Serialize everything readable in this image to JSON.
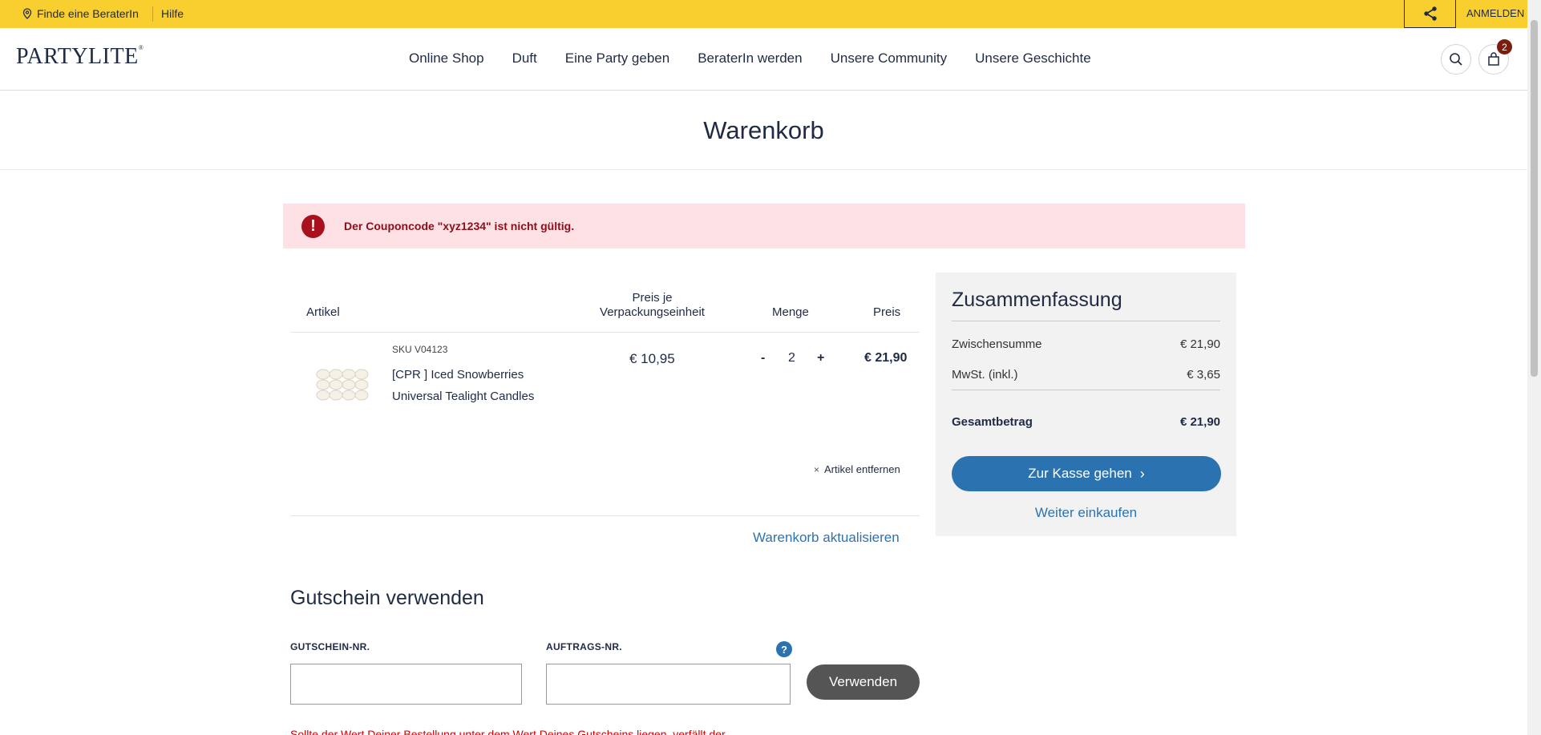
{
  "topbar": {
    "find_consultant": "Finde eine BeraterIn",
    "help": "Hilfe",
    "login": "ANMELDEN"
  },
  "header": {
    "logo": "PARTYLITE",
    "nav": [
      "Online Shop",
      "Duft",
      "Eine Party geben",
      "BeraterIn werden",
      "Unsere Community",
      "Unsere Geschichte"
    ],
    "cart_count": "2"
  },
  "page_title": "Warenkorb",
  "alert": {
    "icon": "!",
    "message": "Der Couponcode \"xyz1234\" ist nicht gültig."
  },
  "cart": {
    "headers": {
      "article": "Artikel",
      "unit_price": "Preis je Verpackungseinheit",
      "quantity": "Menge",
      "price": "Preis"
    },
    "item": {
      "sku": "SKU V04123",
      "name": "[CPR ] Iced Snowberries Universal Tealight Candles",
      "unit_price": "€ 10,95",
      "qty_minus": "-",
      "qty": "2",
      "qty_plus": "+",
      "total": "€ 21,90",
      "remove": "Artikel entfernen",
      "remove_icon": "×"
    },
    "update": "Warenkorb aktualisieren"
  },
  "summary": {
    "title": "Zusammenfassung",
    "subtotal_label": "Zwischensumme",
    "subtotal": "€ 21,90",
    "vat_label": "MwSt. (inkl.)",
    "vat": "€ 3,65",
    "total_label": "Gesamtbetrag",
    "total": "€ 21,90",
    "checkout": "Zur Kasse gehen",
    "checkout_icon": "›",
    "continue": "Weiter einkaufen"
  },
  "coupon": {
    "title": "Gutschein verwenden",
    "voucher_label": "GUTSCHEIN-NR.",
    "order_label": "AUFTRAGS-NR.",
    "help_icon": "?",
    "apply": "Verwenden",
    "warning": "Sollte der Wert Deiner Bestellung unter dem Wert Deines Gutscheins liegen, verfällt der"
  },
  "colors": {
    "topbar": "#f9cf2f",
    "primary": "#2b73b0",
    "alert_bg": "#fde1e5",
    "alert_text": "#8a0f1a"
  }
}
